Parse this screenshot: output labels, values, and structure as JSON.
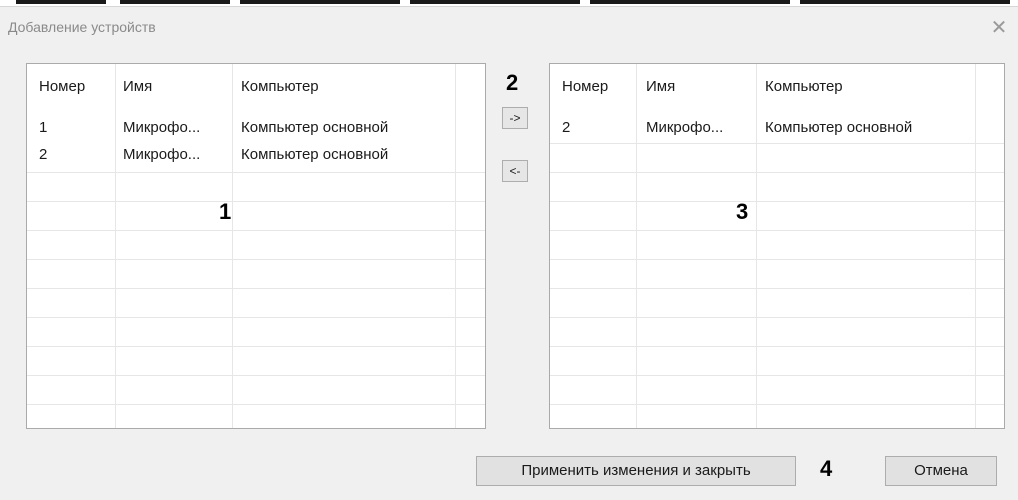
{
  "dialog": {
    "title": "Добавление устройств",
    "close_icon": "close-icon"
  },
  "left_grid": {
    "columns": [
      "Номер",
      "Имя",
      "Компьютер"
    ],
    "rows": [
      [
        "1",
        "Микрофо...",
        "Компьютер основной"
      ],
      [
        "2",
        "Микрофо...",
        "Компьютер основной"
      ]
    ],
    "callout": "1"
  },
  "right_grid": {
    "columns": [
      "Номер",
      "Имя",
      "Компьютер"
    ],
    "rows": [
      [
        "2",
        "Микрофо...",
        "Компьютер основной"
      ]
    ],
    "callout": "3"
  },
  "transfer": {
    "add_label": "->",
    "remove_label": "<-",
    "callout": "2"
  },
  "footer": {
    "apply_label": "Применить изменения и закрыть",
    "cancel_label": "Отмена",
    "callout": "4"
  }
}
